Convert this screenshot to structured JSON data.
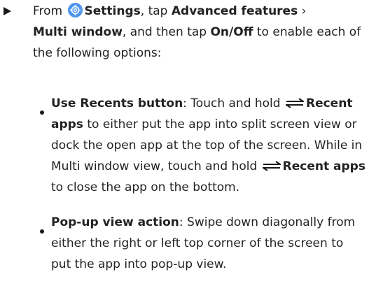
{
  "step": {
    "from": "From",
    "settings": "Settings",
    "tap": ", tap",
    "advanced": "Advanced features",
    "sep": "›",
    "multi_window": "Multi window",
    "then_tap": ", and then tap",
    "onoff": "On/Off",
    "rest": "to enable each of the following options:"
  },
  "options": [
    {
      "title": "Use Recents button",
      "t1": ": Touch and hold",
      "recent1": "Recent apps",
      "t2": "to either put the app into split screen view or dock the open app at the top of the screen. While in Multi window view, touch and hold",
      "recent2": "Recent apps",
      "t3": "to close the app on the bottom."
    },
    {
      "title": "Pop-up view action",
      "text": ": Swipe down diagonally from either the right or left top corner of the screen to put the app into pop-up view."
    }
  ],
  "icons": {
    "step": "triangle-right-icon",
    "settings": "settings-gear-icon",
    "recent": "recent-apps-icon",
    "settings_color": "#4d96f0"
  }
}
